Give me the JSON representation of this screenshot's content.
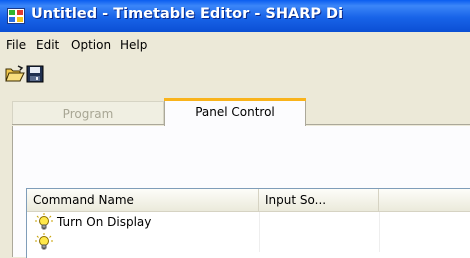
{
  "window": {
    "title": "Untitled - Timetable Editor - SHARP Di",
    "icon": "timetable-app-icon"
  },
  "menu": {
    "items": [
      "File",
      "Edit",
      "Option",
      "Help"
    ]
  },
  "toolbar": {
    "buttons": [
      {
        "icon": "open-folder-icon"
      },
      {
        "icon": "save-disk-icon"
      }
    ]
  },
  "tabs": [
    {
      "label": "Program",
      "active": false
    },
    {
      "label": "Panel Control",
      "active": true
    }
  ],
  "list": {
    "columns": [
      "Command Name",
      "Input So...",
      ""
    ],
    "rows": [
      {
        "icon": "lightbulb-icon",
        "command": "Turn On Display",
        "input": ""
      },
      {
        "icon": "lightbulb-icon",
        "command": "",
        "input": ""
      }
    ]
  },
  "colors": {
    "titlebar": "#0a5ef0",
    "active_tab_accent": "#f9b31b",
    "window_bg": "#ece9d8"
  }
}
